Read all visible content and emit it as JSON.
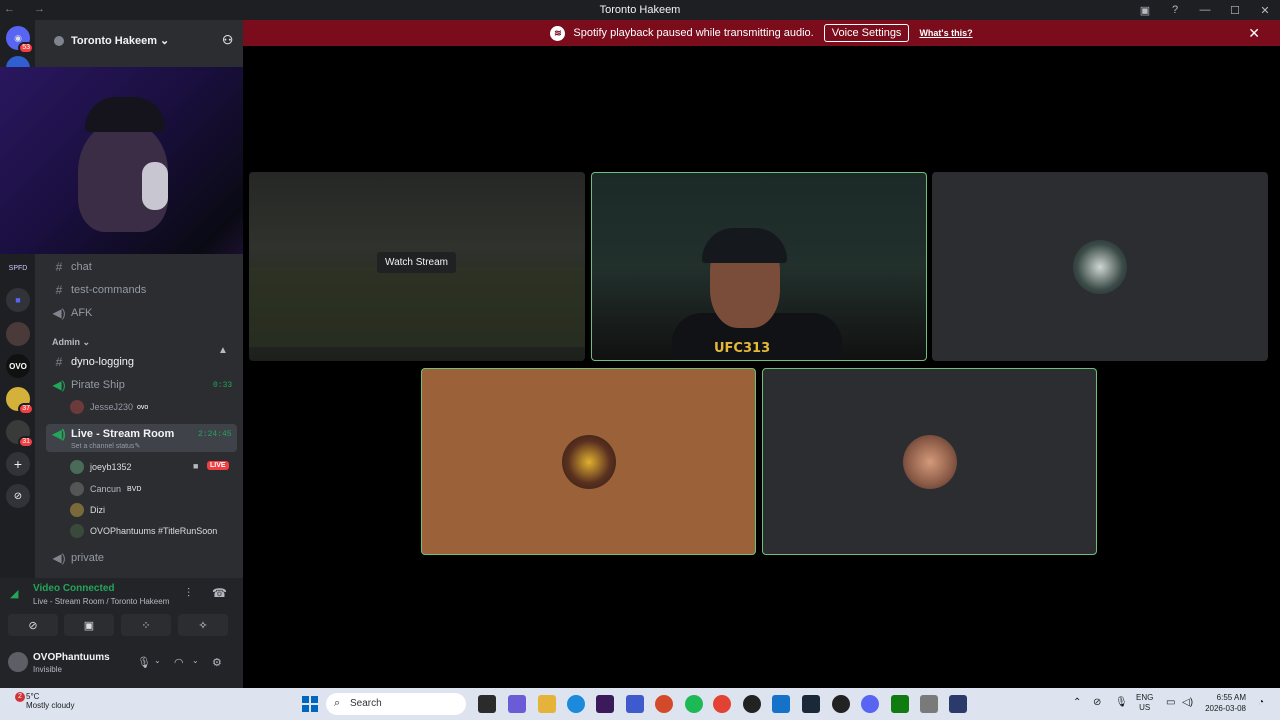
{
  "window": {
    "title": "Toronto Hakeem",
    "nav_arrows": "← →"
  },
  "banner": {
    "message": "Spotify playback paused while transmitting audio.",
    "button": "Voice Settings",
    "link": "What's this?"
  },
  "rail": {
    "badges": [
      "53",
      "37",
      "31"
    ]
  },
  "server": {
    "name": "Toronto Hakeem"
  },
  "channels": {
    "chat": "chat",
    "test_commands": "test-commands",
    "afk": "AFK",
    "admin_category": "Admin",
    "dyno_logging": "dyno-logging",
    "pirate_ship": "Pirate Ship",
    "pirate_ship_timer": "0:33",
    "pirate_member": "JesseJ230",
    "pirate_member_tag": "ovo",
    "live_room": "Live - Stream Room",
    "live_room_timer": "2:24:45",
    "live_room_status": "Set a channel status",
    "members": [
      {
        "name": "joeyb1352",
        "tag": "LIVE"
      },
      {
        "name": "Cancun",
        "tag": "BVD"
      },
      {
        "name": "Dizi",
        "tag": ""
      },
      {
        "name": "OVOPhantuums #TitleRunSoon",
        "tag": ""
      }
    ],
    "private": "private"
  },
  "voice": {
    "status": "Video Connected",
    "location": "Live - Stream Room / Toronto Hakeem"
  },
  "user": {
    "name": "OVOPhantuums",
    "status": "Invisible"
  },
  "stage": {
    "watch_stream": "Watch Stream",
    "shirt_text": "UFC313"
  },
  "taskbar": {
    "weather_badge": "2",
    "temperature": "5°C",
    "weather_desc": "Mostly cloudy",
    "search": "Search",
    "lang_1": "ENG",
    "lang_2": "US",
    "time": "6:55 AM",
    "date": "2026-03-08"
  },
  "colors": {
    "banner": "#7a0c1c",
    "speaking_border": "#6fbf7a",
    "connected": "#23a55a",
    "live": "#f23f43"
  }
}
